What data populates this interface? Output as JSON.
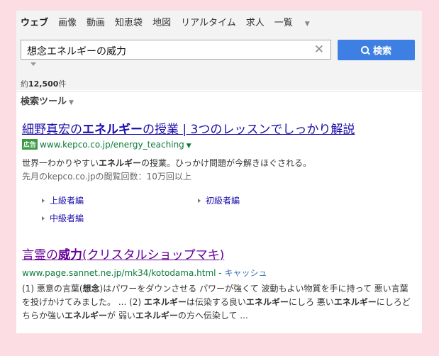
{
  "nav": {
    "tabs": [
      "ウェブ",
      "画像",
      "動画",
      "知恵袋",
      "地図",
      "リアルタイム",
      "求人"
    ],
    "more": "一覧"
  },
  "search": {
    "query": "想念エネルギーの威力",
    "clear_symbol": "✕",
    "button_label": "検索"
  },
  "results_count": {
    "prefix": "約",
    "number": "12,500",
    "suffix": "件"
  },
  "tools_label": "検索ツール",
  "results": [
    {
      "title_parts": [
        "細野真宏の",
        "エネルギー",
        "の授業 | 3つのレッスンでしっかり解説"
      ],
      "ad_label": "広告",
      "url": "www.kepco.co.jp/energy_teaching",
      "desc_parts": [
        "世界一わかりやすい",
        "エネルギー",
        "の授業。ひっかけ問題が今解きほぐされる。"
      ],
      "meta": "先月のkepco.co.jpの閲覧回数：10万回以上",
      "sitelinks": [
        "上級者編",
        "初級者編",
        "中級者編"
      ]
    },
    {
      "title_parts": [
        "言霊の",
        "威力",
        "(クリスタルショップマキ)"
      ],
      "url": "www.page.sannet.ne.jp/mk34/kotodama.html",
      "url_sep": " - ",
      "cache_label": "キャッシュ",
      "desc_parts": [
        "(1) 悪意の言葉(",
        "想念",
        ")はパワーをダウンさせる パワーが強くて 波動もよい物質を手に持って 悪い言葉を投げかけてみました。 ... (2) ",
        "エネルギー",
        "は伝染する良い",
        "エネルギー",
        "にしろ 悪い",
        "エネルギー",
        "にしろどちらか強い",
        "エネルギー",
        "が 弱い",
        "エネルギー",
        "の方へ伝染して ..."
      ]
    }
  ]
}
